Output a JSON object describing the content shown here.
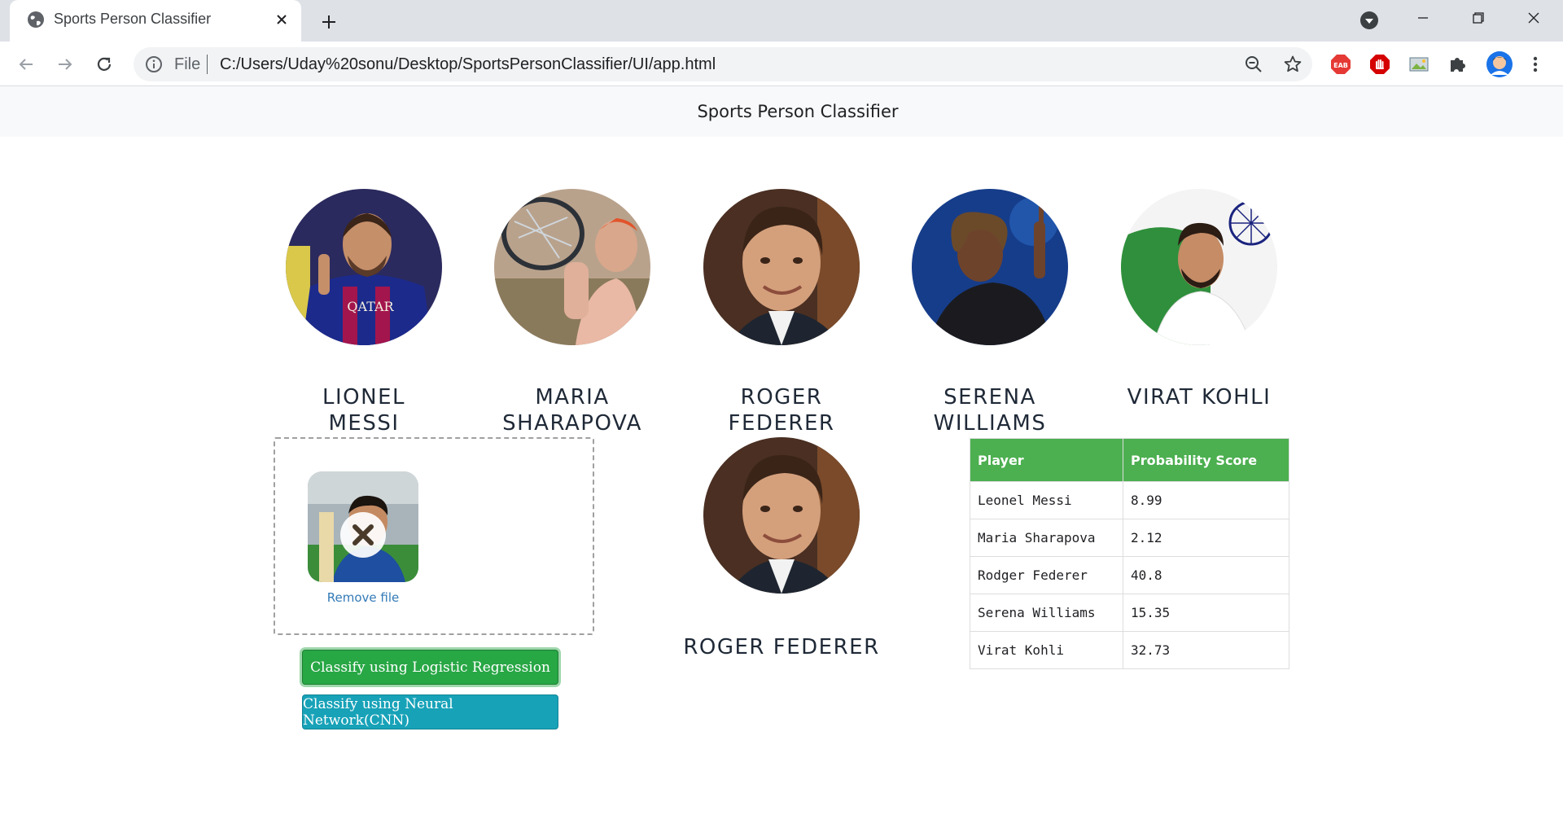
{
  "browser": {
    "tab_title": "Sports Person Classifier",
    "file_label": "File",
    "url": "C:/Users/Uday%20sonu/Desktop/SportsPersonClassifier/UI/app.html",
    "extensions": [
      "eab-adblock-icon",
      "adblock-stop-icon",
      "image-extension-icon",
      "puzzle-extensions-icon"
    ]
  },
  "navbar": {
    "brand": "Sports Person Classifier"
  },
  "players": [
    {
      "name": "Lionel Messi",
      "line1": "LIONEL",
      "line2": "MESSI"
    },
    {
      "name": "Maria Sharapova",
      "line1": "MARIA",
      "line2": "SHARAPOVA"
    },
    {
      "name": "Roger Federer",
      "line1": "ROGER",
      "line2": "FEDERER"
    },
    {
      "name": "Serena Williams",
      "line1": "SERENA",
      "line2": "WILLIAMS"
    },
    {
      "name": "Virat Kohli",
      "line1": "VIRAT KOHLI",
      "line2": ""
    }
  ],
  "upload": {
    "remove_label": "Remove file"
  },
  "buttons": {
    "logistic": "Classify using Logistic Regression",
    "cnn": "Classify using Neural Network(CNN)"
  },
  "result": {
    "name": "ROGER FEDERER"
  },
  "table": {
    "headers": [
      "Player",
      "Probability Score"
    ],
    "rows": [
      [
        "Leonel Messi",
        "8.99"
      ],
      [
        "Maria Sharapova",
        "2.12"
      ],
      [
        "Rodger Federer",
        "40.8"
      ],
      [
        "Serena Williams",
        "15.35"
      ],
      [
        "Virat Kohli",
        "32.73"
      ]
    ]
  },
  "colors": {
    "success": "#28a745",
    "info": "#17a2b8",
    "table_header": "#4caf50",
    "link": "#337ab7"
  }
}
